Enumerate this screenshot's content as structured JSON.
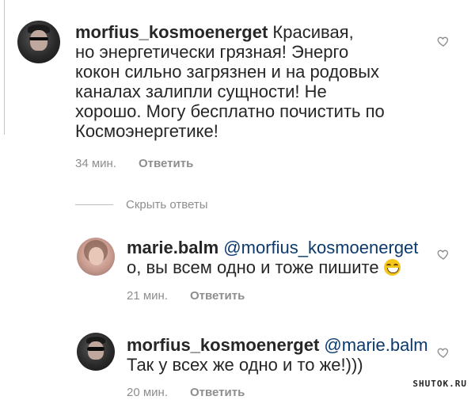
{
  "comments": [
    {
      "username": "morfius_kosmoenerget",
      "text_lines": [
        "Красивая,",
        "но энергетически грязная! Энерго",
        "кокон сильно загрязнен и на родовых",
        "каналах залипли сущности! Не",
        "хорошо. Могу бесплатно почистить по",
        "Космоэнергетике!"
      ],
      "time": "34 мин.",
      "reply_label": "Ответить"
    }
  ],
  "hide_replies": "Скрыть ответы",
  "replies": [
    {
      "username": "marie.balm",
      "mention": "@morfius_kosmoenerget",
      "text": "о, вы всем одно и тоже пишите",
      "time": "21 мин.",
      "reply_label": "Ответить",
      "emoji": "grinning-sweat-emoji"
    },
    {
      "username": "morfius_kosmoenerget",
      "mention": "@marie.balm",
      "text": "Так у всех же одно и то же!)))",
      "time": "20 мин.",
      "reply_label": "Ответить"
    }
  ],
  "watermark": "SHUTOK.RU",
  "icons": {
    "like": "heart-outline-icon"
  }
}
